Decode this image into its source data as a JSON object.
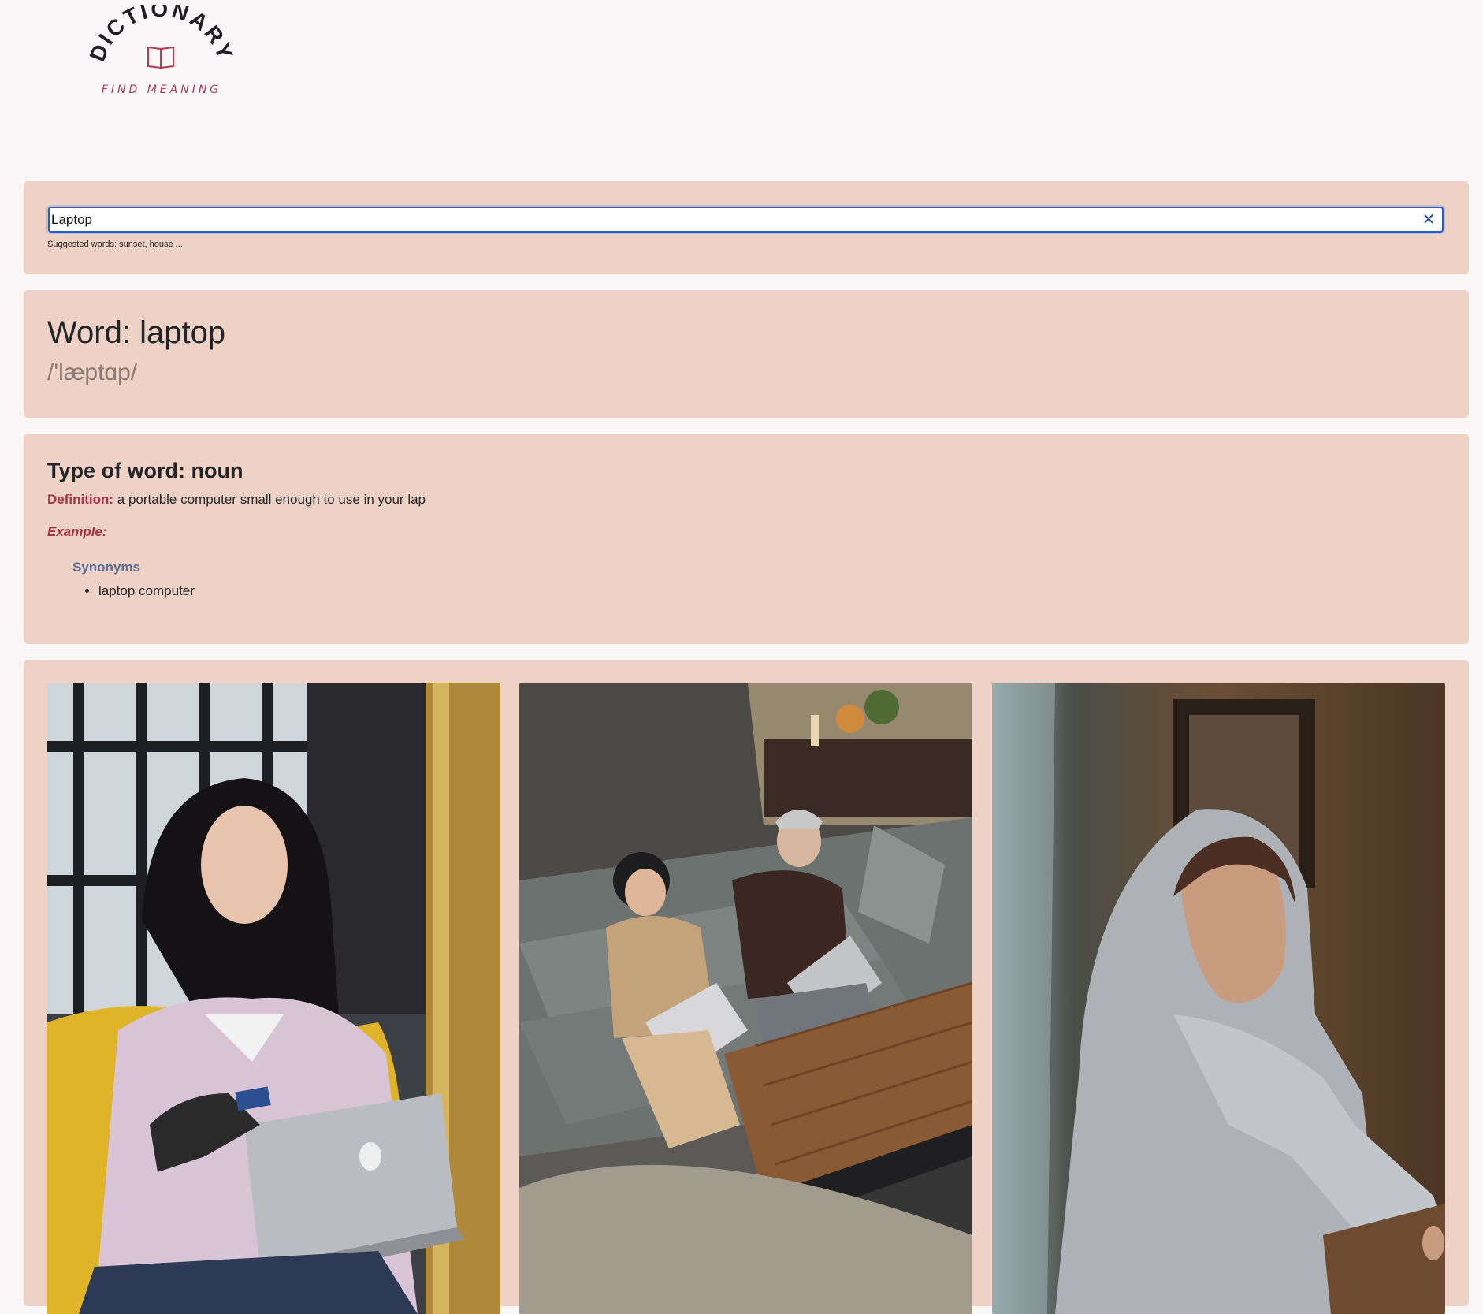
{
  "logo": {
    "arc_text": "DICTIONARY",
    "tagline": "FIND MEANING",
    "icon": "book-icon"
  },
  "search": {
    "value": "Laptop",
    "clear_icon": "✕",
    "suggestion": "Suggested words: sunset, house ..."
  },
  "word": {
    "title": "Word: laptop",
    "phonetic": "/'læptɑp/"
  },
  "meaning": {
    "type_title": "Type of word: noun",
    "definition_label": "Definition:",
    "definition_text": " a portable computer small enough to use in your lap",
    "example_label": "Example:",
    "synonyms_label": "Synonyms",
    "synonyms": [
      "laptop computer"
    ]
  },
  "images": [
    {
      "name": "photo-woman-laptop-credit-card"
    },
    {
      "name": "photo-couple-sofa-laptops"
    },
    {
      "name": "photo-woman-hijab-laptop"
    }
  ],
  "colors": {
    "page_bg": "#faf7f8",
    "card_bg": "#eed2c5",
    "accent": "#a8324a",
    "synonym": "#5a6f99",
    "focus": "#1f5fd1"
  }
}
